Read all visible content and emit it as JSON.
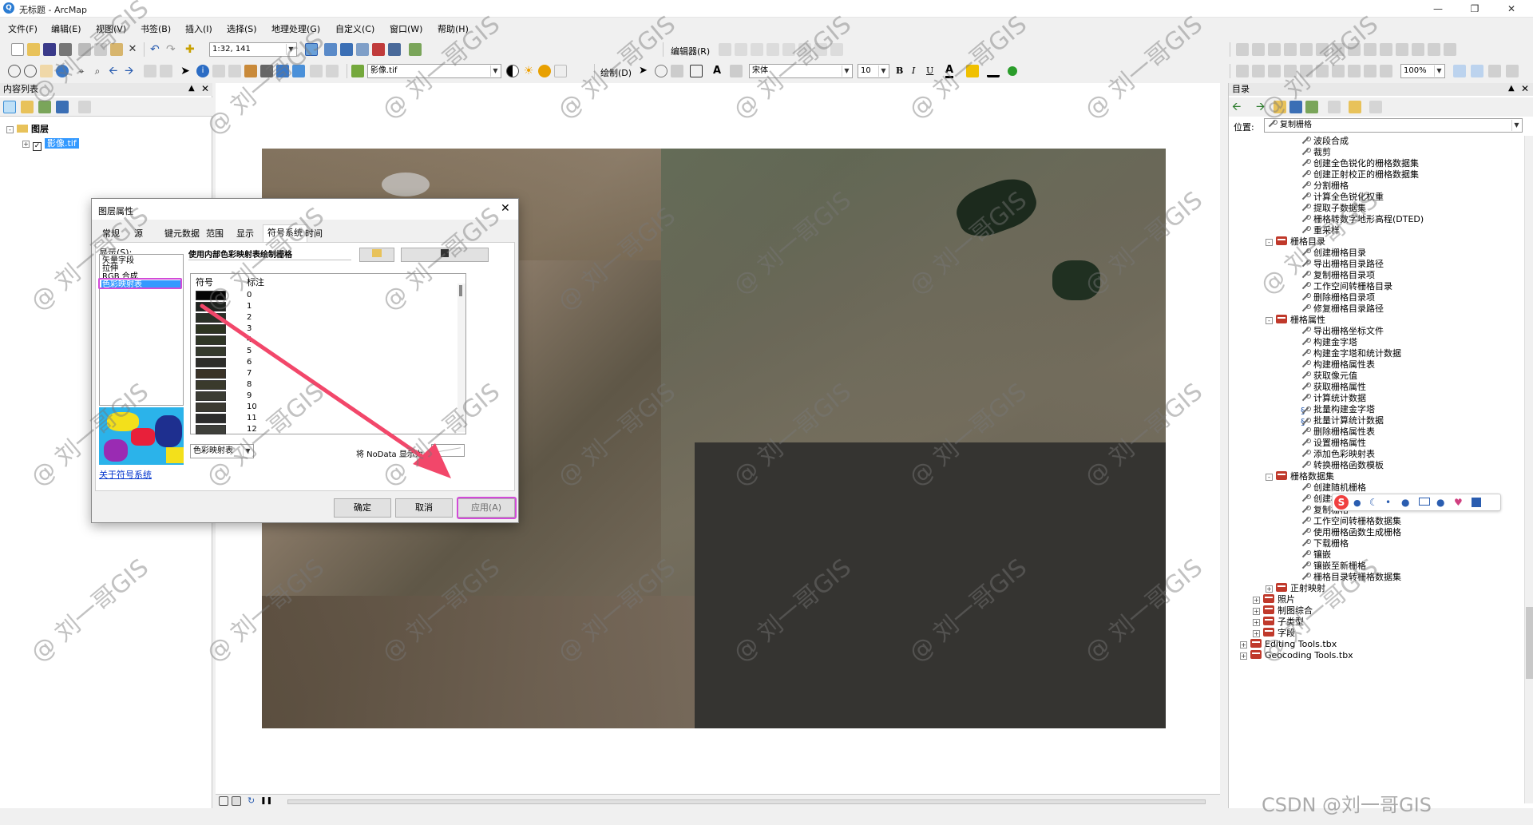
{
  "window": {
    "title": "无标题 - ArcMap",
    "app_icon": "arcmap-icon"
  },
  "menu": [
    "文件(F)",
    "编辑(E)",
    "视图(V)",
    "书签(B)",
    "插入(I)",
    "选择(S)",
    "地理处理(G)",
    "自定义(C)",
    "窗口(W)",
    "帮助(H)"
  ],
  "toolbar": {
    "scale": "1:32, 141",
    "editor_label": "编辑器(R)",
    "layer_combo": "影像.tif",
    "draw_label": "绘制(D)",
    "font_name": "宋体",
    "font_size": "10",
    "bold": "B",
    "italic": "I",
    "underline": "U",
    "font_color_label": "A",
    "zoom_pct": "100%"
  },
  "toc": {
    "title": "内容列表",
    "root": "图层",
    "layer": "影像.tif"
  },
  "catalog": {
    "title": "目录",
    "location_label": "位置:",
    "location_value": "复制栅格",
    "items": [
      {
        "label": "波段合成",
        "kind": "tool"
      },
      {
        "label": "裁剪",
        "kind": "tool"
      },
      {
        "label": "创建全色锐化的栅格数据集",
        "kind": "tool"
      },
      {
        "label": "创建正射校正的栅格数据集",
        "kind": "tool"
      },
      {
        "label": "分割栅格",
        "kind": "tool"
      },
      {
        "label": "计算全色锐化权重",
        "kind": "tool"
      },
      {
        "label": "提取子数据集",
        "kind": "tool"
      },
      {
        "label": "栅格转数字地形高程(DTED)",
        "kind": "tool"
      },
      {
        "label": "重采样",
        "kind": "tool"
      },
      {
        "label": "栅格目录",
        "kind": "toolset"
      },
      {
        "label": "创建栅格目录",
        "kind": "tool"
      },
      {
        "label": "导出栅格目录路径",
        "kind": "tool"
      },
      {
        "label": "复制栅格目录项",
        "kind": "tool"
      },
      {
        "label": "工作空间转栅格目录",
        "kind": "tool"
      },
      {
        "label": "删除栅格目录项",
        "kind": "tool"
      },
      {
        "label": "修复栅格目录路径",
        "kind": "tool"
      },
      {
        "label": "栅格属性",
        "kind": "toolset"
      },
      {
        "label": "导出栅格坐标文件",
        "kind": "tool"
      },
      {
        "label": "构建金字塔",
        "kind": "tool"
      },
      {
        "label": "构建金字塔和统计数据",
        "kind": "tool"
      },
      {
        "label": "构建栅格属性表",
        "kind": "tool"
      },
      {
        "label": "获取像元值",
        "kind": "tool"
      },
      {
        "label": "获取栅格属性",
        "kind": "tool"
      },
      {
        "label": "计算统计数据",
        "kind": "tool"
      },
      {
        "label": "批量构建金字塔",
        "kind": "script"
      },
      {
        "label": "批量计算统计数据",
        "kind": "script"
      },
      {
        "label": "删除栅格属性表",
        "kind": "tool"
      },
      {
        "label": "设置栅格属性",
        "kind": "tool"
      },
      {
        "label": "添加色彩映射表",
        "kind": "tool"
      },
      {
        "label": "转换栅格函数模板",
        "kind": "tool"
      },
      {
        "label": "栅格数据集",
        "kind": "toolset"
      },
      {
        "label": "创建随机栅格",
        "kind": "tool"
      },
      {
        "label": "创建栅格数据集",
        "kind": "tool"
      },
      {
        "label": "复制栅格",
        "kind": "tool"
      },
      {
        "label": "工作空间转栅格数据集",
        "kind": "tool"
      },
      {
        "label": "使用栅格函数生成栅格",
        "kind": "tool"
      },
      {
        "label": "下载栅格",
        "kind": "tool"
      },
      {
        "label": "镶嵌",
        "kind": "tool"
      },
      {
        "label": "镶嵌至新栅格",
        "kind": "tool"
      },
      {
        "label": "栅格目录转栅格数据集",
        "kind": "tool"
      },
      {
        "label": "正射映射",
        "kind": "toolset-collapsed"
      },
      {
        "label": "照片",
        "kind": "toolset-collapsed-l1"
      },
      {
        "label": "制图综合",
        "kind": "toolset-collapsed-l1"
      },
      {
        "label": "子类型",
        "kind": "toolset-collapsed-l1"
      },
      {
        "label": "字段",
        "kind": "toolset-collapsed-l1"
      },
      {
        "label": "Editing Tools.tbx",
        "kind": "toolbox"
      },
      {
        "label": "Geocoding Tools.tbx",
        "kind": "toolbox"
      }
    ]
  },
  "dialog": {
    "title": "图层属性",
    "tabs": [
      "常规",
      "源",
      "键元数据",
      "范围",
      "显示",
      "符号系统",
      "时间"
    ],
    "active_tab": "符号系统",
    "show_label": "显示(S):",
    "show_items": [
      "矢量字段",
      "拉伸",
      "RGB 合成",
      "色彩映射表"
    ],
    "selected_show": "色彩映射表",
    "heading": "使用内部色彩映射表绘制栅格",
    "col_symbol": "符号",
    "col_label": "标注",
    "rows": [
      {
        "label": "0",
        "color": "#050505"
      },
      {
        "label": "1",
        "color": "#1e221e"
      },
      {
        "label": "2",
        "color": "#2a3027"
      },
      {
        "label": "3",
        "color": "#2d3421"
      },
      {
        "label": "4",
        "color": "#2f3626"
      },
      {
        "label": "5",
        "color": "#353a2d"
      },
      {
        "label": "6",
        "color": "#2d2d2a"
      },
      {
        "label": "7",
        "color": "#3a3226"
      },
      {
        "label": "8",
        "color": "#3a3a2c"
      },
      {
        "label": "9",
        "color": "#3b3c33"
      },
      {
        "label": "10",
        "color": "#3c3a32"
      },
      {
        "label": "11",
        "color": "#2c2c2c"
      },
      {
        "label": "12",
        "color": "#3e3f3a"
      }
    ],
    "colormap_combo": "色彩映射表",
    "nodata_label": "将 NoData 显示为",
    "about_link": "关于符号系统",
    "ok": "确定",
    "cancel": "取消",
    "apply": "应用(A)",
    "highlight_color": "#d24bd8",
    "arrow_color": "#f2476a"
  },
  "watermark": {
    "text": "@ 刘一哥GIS",
    "footer": "CSDN @刘一哥GIS"
  }
}
